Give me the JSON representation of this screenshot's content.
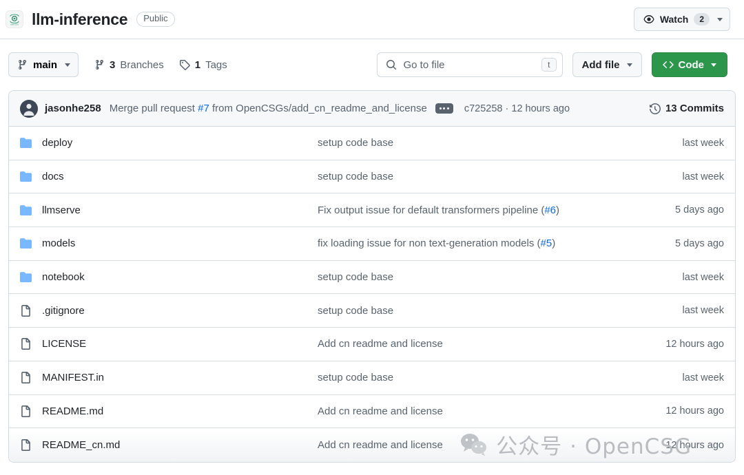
{
  "header": {
    "owner_avatar_icon": "opencsg-logo-icon",
    "repo_name": "llm-inference",
    "visibility": "Public",
    "watch": {
      "icon": "eye-icon",
      "label": "Watch",
      "count": "2"
    }
  },
  "toolbar": {
    "branch": {
      "icon": "branch-icon",
      "name": "main"
    },
    "branches": {
      "icon": "branch-icon",
      "count": "3",
      "label": "Branches"
    },
    "tags": {
      "icon": "tag-icon",
      "count": "1",
      "label": "Tags"
    },
    "go_to_file": {
      "icon": "search-icon",
      "placeholder": "Go to file",
      "shortcut": "t"
    },
    "add_file": {
      "label": "Add file"
    },
    "code": {
      "icon": "code-icon",
      "label": "Code"
    }
  },
  "commit_bar": {
    "author": "jasonhe258",
    "message_prefix": "Merge pull request ",
    "pr_number": "#7",
    "message_suffix": " from OpenCSGs/add_cn_readme_and_license",
    "expand_icon": "ellipsis-icon",
    "sha": "c725258",
    "separator": " · ",
    "relative_time": "12 hours ago",
    "history_icon": "history-icon",
    "commits_count": "13 Commits"
  },
  "files": [
    {
      "type": "folder",
      "icon": "folder-icon",
      "name": "deploy",
      "message": "setup code base",
      "pr": "",
      "message_tail": "",
      "age": "last week"
    },
    {
      "type": "folder",
      "icon": "folder-icon",
      "name": "docs",
      "message": "setup code base",
      "pr": "",
      "message_tail": "",
      "age": "last week"
    },
    {
      "type": "folder",
      "icon": "folder-icon",
      "name": "llmserve",
      "message": "Fix output issue for default transformers pipeline (",
      "pr": "#6",
      "message_tail": ")",
      "age": "5 days ago"
    },
    {
      "type": "folder",
      "icon": "folder-icon",
      "name": "models",
      "message": "fix loading issue for non text-generation models (",
      "pr": "#5",
      "message_tail": ")",
      "age": "5 days ago"
    },
    {
      "type": "folder",
      "icon": "folder-icon",
      "name": "notebook",
      "message": "setup code base",
      "pr": "",
      "message_tail": "",
      "age": "last week"
    },
    {
      "type": "file",
      "icon": "file-icon",
      "name": ".gitignore",
      "message": "setup code base",
      "pr": "",
      "message_tail": "",
      "age": "last week"
    },
    {
      "type": "file",
      "icon": "file-icon",
      "name": "LICENSE",
      "message": "Add cn readme and license",
      "pr": "",
      "message_tail": "",
      "age": "12 hours ago"
    },
    {
      "type": "file",
      "icon": "file-icon",
      "name": "MANIFEST.in",
      "message": "setup code base",
      "pr": "",
      "message_tail": "",
      "age": "last week"
    },
    {
      "type": "file",
      "icon": "file-icon",
      "name": "README.md",
      "message": "Add cn readme and license",
      "pr": "",
      "message_tail": "",
      "age": "12 hours ago"
    },
    {
      "type": "file",
      "icon": "file-icon",
      "name": "README_cn.md",
      "message": "Add cn readme and license",
      "pr": "",
      "message_tail": "",
      "age": "12 hours ago"
    }
  ],
  "watermark": {
    "icon": "wechat-icon",
    "text": "公众号 · OpenCSG"
  },
  "colors": {
    "accent_link": "#0969da",
    "code_button_green": "#2c974b",
    "folder_blue": "#79b8ff",
    "muted_text": "#59636e",
    "border": "#d1d9e0",
    "subtle_bg": "#f6f8fa"
  }
}
